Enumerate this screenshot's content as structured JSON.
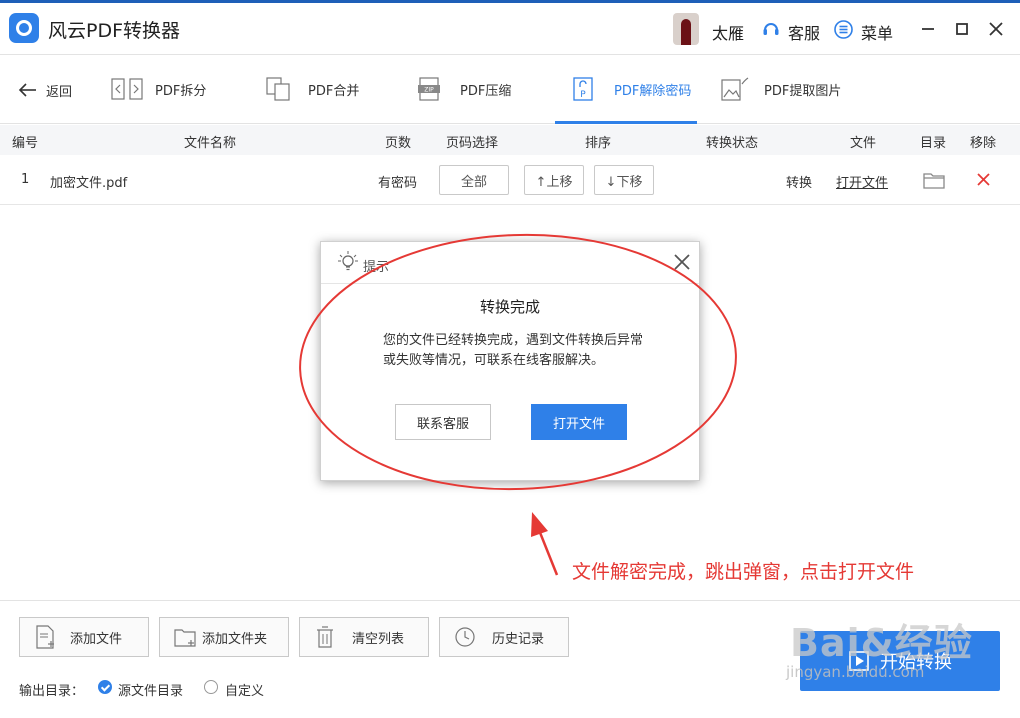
{
  "app": {
    "title": "风云PDF转换器",
    "user": "太雁",
    "service": "客服",
    "menu": "菜单"
  },
  "toolbar": {
    "back": "返回",
    "tools": [
      "PDF拆分",
      "PDF合并",
      "PDF压缩",
      "PDF解除密码",
      "PDF提取图片"
    ],
    "active": "PDF解除密码"
  },
  "table": {
    "headers": {
      "no": "编号",
      "name": "文件名称",
      "pages": "页数",
      "page_select": "页码选择",
      "sort": "排序",
      "status": "转换状态",
      "file": "文件",
      "dir": "目录",
      "remove": "移除"
    },
    "rows": [
      {
        "no": "1",
        "name": "加密文件.pdf",
        "pages": "有密码",
        "page_select": "全部",
        "up": "↑上移",
        "down": "↓下移",
        "status": "转换",
        "file": "打开文件"
      }
    ]
  },
  "dialog": {
    "title": "提示",
    "heading": "转换完成",
    "message": "您的文件已经转换完成，遇到文件转换后异常或失败等情况，可联系在线客服解决。",
    "contact": "联系客服",
    "open": "打开文件"
  },
  "annotation": {
    "text": "文件解密完成，跳出弹窗，点击打开文件",
    "color": "#e53935"
  },
  "bottom": {
    "buttons": [
      "添加文件",
      "添加文件夹",
      "清空列表",
      "历史记录"
    ],
    "output_label": "输出目录：",
    "options": [
      {
        "label": "源文件目录",
        "checked": true
      },
      {
        "label": "自定义",
        "checked": false
      }
    ],
    "start": "开始转换"
  },
  "watermark": {
    "line1": "Bai&经验",
    "line2": "jingyan.baidu.com"
  },
  "colors": {
    "accent": "#2f80e8",
    "annotation_red": "#e53935"
  }
}
